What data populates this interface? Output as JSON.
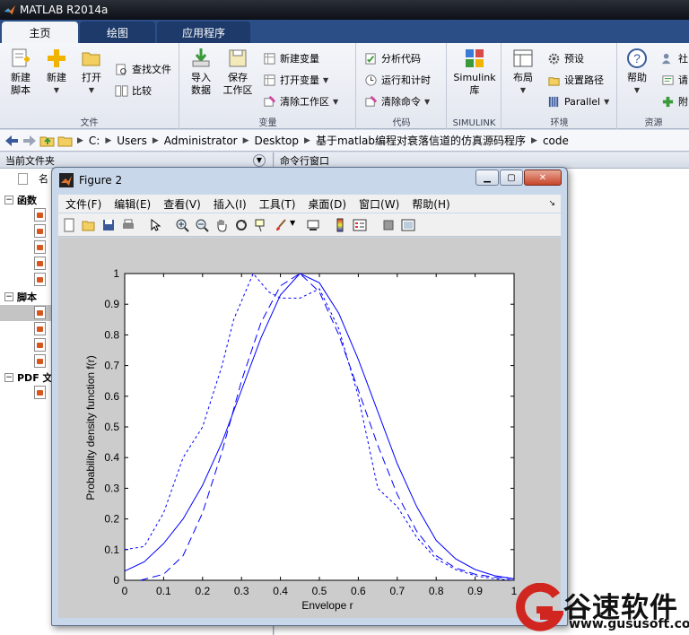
{
  "app": {
    "title": "MATLAB R2014a"
  },
  "tabs": [
    {
      "label": "主页"
    },
    {
      "label": "绘图"
    },
    {
      "label": "应用程序"
    }
  ],
  "ribbon": {
    "file": {
      "label": "文件",
      "new_script": "新建\n脚本",
      "new": "新建",
      "open": "打开",
      "find_files": "查找文件",
      "compare": "比较"
    },
    "variable": {
      "label": "变量",
      "import": "导入\n数据",
      "save_workspace": "保存\n工作区",
      "new_variable": "新建变量",
      "open_variable": "打开变量",
      "clear_workspace": "清除工作区"
    },
    "code": {
      "label": "代码",
      "analyze": "分析代码",
      "run_time": "运行和计时",
      "clear_commands": "清除命令"
    },
    "simulink": {
      "label": "SIMULINK",
      "button": "Simulink\n库"
    },
    "environment": {
      "label": "环境",
      "layout": "布局",
      "preferences": "预设",
      "set_path": "设置路径",
      "parallel": "Parallel"
    },
    "resources": {
      "label": "资源",
      "help": "帮助",
      "community": "社",
      "request": "请",
      "addons": "附"
    }
  },
  "address": {
    "crumbs": [
      "C:",
      "Users",
      "Administrator",
      "Desktop",
      "基于matlab编程对衰落信道的仿真源码程序",
      "code"
    ]
  },
  "current_folder": {
    "title": "当前文件夹",
    "name_col": "名",
    "groups": [
      {
        "label": "函数"
      },
      {
        "label": "脚本"
      },
      {
        "label": "PDF 文"
      }
    ]
  },
  "command_window": {
    "title": "命令行窗口"
  },
  "figure": {
    "title": "Figure 2",
    "menus": [
      "文件(F)",
      "编辑(E)",
      "查看(V)",
      "插入(I)",
      "工具(T)",
      "桌面(D)",
      "窗口(W)",
      "帮助(H)"
    ]
  },
  "chart_data": {
    "type": "line",
    "xlabel": "Envelope r",
    "ylabel": "Probability density function f(r)",
    "xlim": [
      0,
      1
    ],
    "ylim": [
      0,
      1
    ],
    "xticks": [
      "0",
      "0.1",
      "0.2",
      "0.3",
      "0.4",
      "0.5",
      "0.6",
      "0.7",
      "0.8",
      "0.9",
      "1"
    ],
    "yticks": [
      "0",
      "0.1",
      "0.2",
      "0.3",
      "0.4",
      "0.5",
      "0.6",
      "0.7",
      "0.8",
      "0.9",
      "1"
    ],
    "grid": false,
    "series": [
      {
        "style": "solid",
        "x": [
          0,
          0.05,
          0.1,
          0.15,
          0.2,
          0.25,
          0.3,
          0.35,
          0.4,
          0.45,
          0.5,
          0.55,
          0.6,
          0.65,
          0.7,
          0.75,
          0.8,
          0.85,
          0.9,
          0.95,
          1.0
        ],
        "y": [
          0.03,
          0.06,
          0.12,
          0.2,
          0.31,
          0.45,
          0.62,
          0.79,
          0.93,
          1.0,
          0.97,
          0.87,
          0.72,
          0.55,
          0.38,
          0.24,
          0.13,
          0.07,
          0.035,
          0.015,
          0.005
        ]
      },
      {
        "style": "dashed",
        "x": [
          0.04,
          0.1,
          0.15,
          0.2,
          0.25,
          0.3,
          0.35,
          0.4,
          0.45,
          0.5,
          0.55,
          0.6,
          0.65,
          0.7,
          0.75,
          0.8,
          0.85,
          0.9,
          0.95,
          1.0
        ],
        "y": [
          0.0,
          0.02,
          0.08,
          0.22,
          0.42,
          0.65,
          0.84,
          0.96,
          1.0,
          0.94,
          0.8,
          0.62,
          0.44,
          0.28,
          0.16,
          0.08,
          0.04,
          0.02,
          0.01,
          0.005
        ]
      },
      {
        "style": "dotted",
        "x": [
          0,
          0.05,
          0.1,
          0.15,
          0.2,
          0.25,
          0.28,
          0.33,
          0.37,
          0.4,
          0.45,
          0.5,
          0.55,
          0.6,
          0.65,
          0.7,
          0.75,
          0.8,
          0.85,
          0.9,
          0.95,
          1.0
        ],
        "y": [
          0.1,
          0.11,
          0.22,
          0.4,
          0.5,
          0.7,
          0.85,
          1.0,
          0.94,
          0.92,
          0.92,
          0.95,
          0.82,
          0.6,
          0.3,
          0.24,
          0.14,
          0.07,
          0.035,
          0.015,
          0.005,
          0.0
        ]
      }
    ]
  },
  "watermark": {
    "text": "谷速软件",
    "url": "www.gususoft.com"
  }
}
